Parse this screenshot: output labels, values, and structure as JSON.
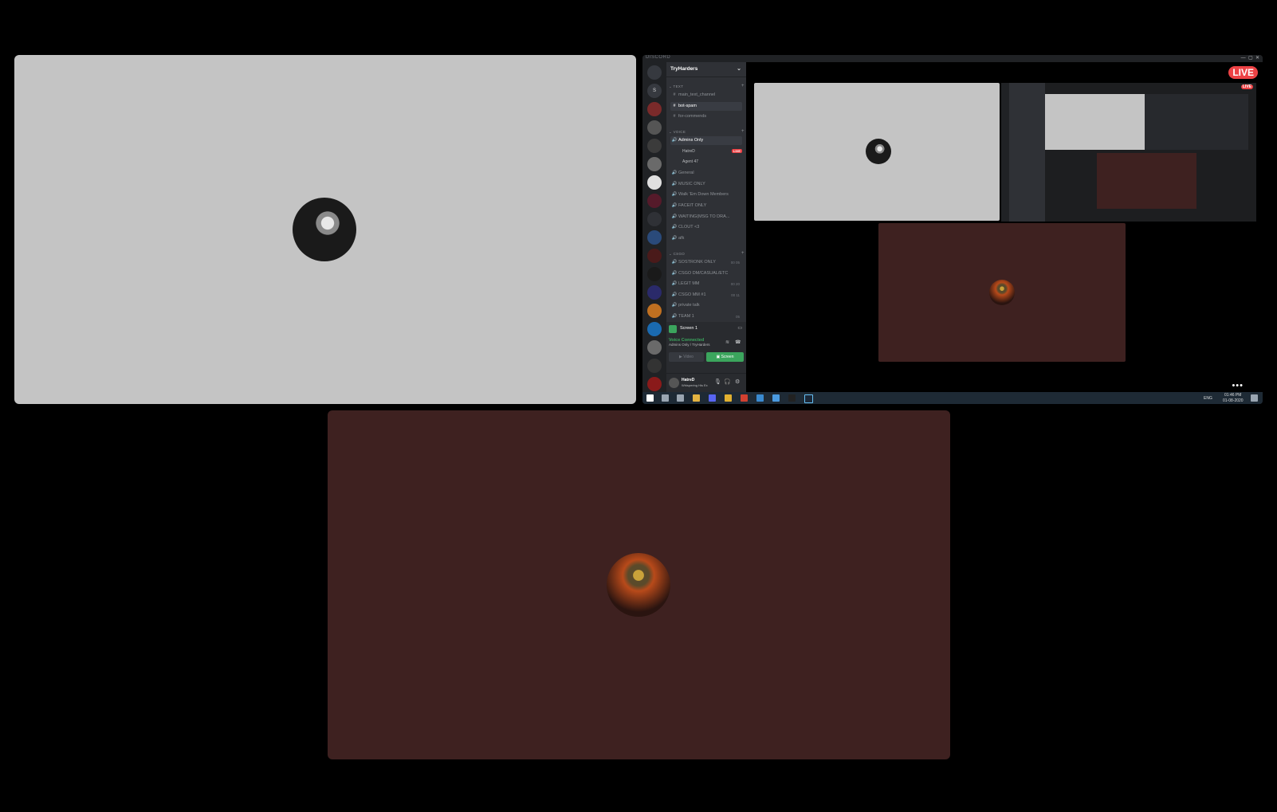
{
  "share": {
    "app_name": "DISCORD",
    "server_name": "TryHarders",
    "categories": {
      "text": "TEXT",
      "voice": "VOICE",
      "csgo": "CSGO"
    },
    "text_channels": [
      "main_text_channel",
      "bot-spam",
      "for-commends"
    ],
    "voice_channels": [
      "Admins Only",
      "General",
      "MUSIC ONLY",
      "Walk 'Em Down Members",
      "FACEIT ONLY",
      "WAITING(MSG TO DRA...",
      "CLOUT <3",
      "afk"
    ],
    "voice_members": [
      "HatreD",
      "Agent 47"
    ],
    "member_live": "LIVE",
    "csgo_channels": [
      "SOSTRONK ONLY",
      "CSGO DM/CASUAL/ETC",
      "LEGIT MM",
      "CSGO MM #1",
      "private talk",
      "TEAM 1"
    ],
    "csgo_counts": [
      "00 05",
      "",
      "00 20",
      "00 11",
      "",
      "05"
    ],
    "screen_label": "Screen 1",
    "voice_connected": "Voice Connected",
    "voice_location": "Admins Only / TryHarders",
    "video_button": "Video",
    "screen_button": "Screen",
    "username": "HatreD",
    "user_status": "Whispering His Ex",
    "live_badge": "LIVE",
    "more": "•••",
    "clock_time": "01:46 PM",
    "clock_date": "01-08-2020",
    "lang": "ENG",
    "guild_letter": "S"
  },
  "colors": {
    "gray_tile": "#c4c4c4",
    "brown_tile": "#3e2120",
    "live": "#ed4245",
    "green": "#3ba55d"
  }
}
